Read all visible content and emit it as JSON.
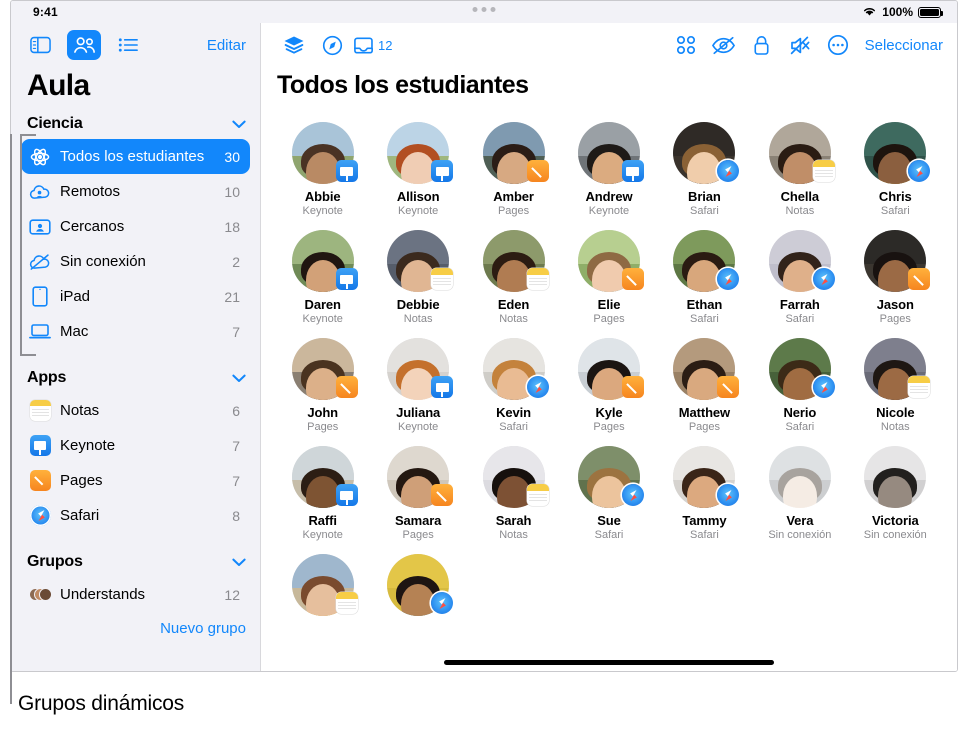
{
  "statusbar": {
    "time": "9:41",
    "battery_pct": "100%",
    "wifi_icon": "wifi-icon",
    "battery_icon": "battery-full-icon"
  },
  "sidebar": {
    "toolbar": {
      "sidebar_toggle_icon": "sidebar-toggle-icon",
      "people_icon": "people-icon",
      "list_icon": "list-icon",
      "edit_label": "Editar"
    },
    "title": "Aula",
    "class_section": {
      "label": "Ciencia",
      "chevron": "chevron-down-icon"
    },
    "class_items": [
      {
        "label": "Todos los estudiantes",
        "count": "30",
        "icon": "atom-icon",
        "selected": true
      },
      {
        "label": "Remotos",
        "count": "10",
        "icon": "cloud-person-icon",
        "selected": false
      },
      {
        "label": "Cercanos",
        "count": "18",
        "icon": "person-card-icon",
        "selected": false
      },
      {
        "label": "Sin conexión",
        "count": "2",
        "icon": "cloud-slash-icon",
        "selected": false
      },
      {
        "label": "iPad",
        "count": "21",
        "icon": "ipad-icon",
        "selected": false
      },
      {
        "label": "Mac",
        "count": "7",
        "icon": "laptop-icon",
        "selected": false
      }
    ],
    "apps_section": {
      "label": "Apps",
      "chevron": "chevron-down-icon"
    },
    "apps_items": [
      {
        "label": "Notas",
        "count": "6",
        "icon": "notes-app-icon"
      },
      {
        "label": "Keynote",
        "count": "7",
        "icon": "keynote-app-icon"
      },
      {
        "label": "Pages",
        "count": "7",
        "icon": "pages-app-icon"
      },
      {
        "label": "Safari",
        "count": "8",
        "icon": "safari-app-icon"
      }
    ],
    "groups_section": {
      "label": "Grupos",
      "chevron": "chevron-down-icon"
    },
    "groups_items": [
      {
        "label": "Understands",
        "count": "12",
        "icon": "group-avatars-icon"
      }
    ],
    "new_group_label": "Nuevo grupo"
  },
  "main": {
    "toolbar": {
      "layers_icon": "layers-icon",
      "navigate_icon": "compass-icon",
      "inbox_icon": "inbox-icon",
      "inbox_count": "12",
      "grid_icon": "grid-four-icon",
      "hide_screen_icon": "eye-slash-icon",
      "lock_icon": "lock-icon",
      "mute_icon": "speaker-slash-icon",
      "more_icon": "ellipsis-circle-icon",
      "select_label": "Seleccionar"
    },
    "title": "Todos los estudiantes",
    "students": [
      {
        "name": "Abbie",
        "app": "Keynote",
        "badge": "keynote",
        "skin": "#b98a64",
        "hair": "#4a3324",
        "bg_top": "#a9c4d8",
        "bg_bottom": "#8fa56f",
        "shirt": "#e7e3dd"
      },
      {
        "name": "Allison",
        "app": "Keynote",
        "badge": "keynote",
        "skin": "#f0cdb4",
        "hair": "#b24f22",
        "bg_top": "#bcd4e6",
        "bg_bottom": "#9fb77e",
        "shirt": "#efeae4"
      },
      {
        "name": "Amber",
        "app": "Pages",
        "badge": "pages",
        "skin": "#d7a982",
        "hair": "#2b1d16",
        "bg_top": "#7f9ab0",
        "bg_bottom": "#4f5f55",
        "shirt": "#3a3632"
      },
      {
        "name": "Andrew",
        "app": "Keynote",
        "badge": "keynote",
        "skin": "#dbab80",
        "hair": "#1e1a17",
        "bg_top": "#9aa0a5",
        "bg_bottom": "#6f7478",
        "shirt": "#2c2b29"
      },
      {
        "name": "Brian",
        "app": "Safari",
        "badge": "safari",
        "skin": "#f0cdab",
        "hair": "#8a6135",
        "bg_top": "#2f2a26",
        "bg_bottom": "#3a332c",
        "shirt": "#1d1a17"
      },
      {
        "name": "Chella",
        "app": "Notas",
        "badge": "notes",
        "skin": "#c08e68",
        "hair": "#2a1c13",
        "bg_top": "#b0a79a",
        "bg_bottom": "#8a8276",
        "shirt": "#2e2a26"
      },
      {
        "name": "Chris",
        "app": "Safari",
        "badge": "safari",
        "skin": "#8b5f3f",
        "hair": "#1d140e",
        "bg_top": "#3e6a5f",
        "bg_bottom": "#2f5249",
        "shirt": "#d9b33a"
      },
      {
        "name": "Daren",
        "app": "Keynote",
        "badge": "keynote",
        "skin": "#d2a178",
        "hair": "#201611",
        "bg_top": "#9db57f",
        "bg_bottom": "#6f8a56",
        "shirt": "#3f4a3a"
      },
      {
        "name": "Debbie",
        "app": "Notas",
        "badge": "notes",
        "skin": "#e0b693",
        "hair": "#3b2a1e",
        "bg_top": "#6b7382",
        "bg_bottom": "#565d6a",
        "shirt": "#e9e5df"
      },
      {
        "name": "Eden",
        "app": "Notas",
        "badge": "notes",
        "skin": "#b07c52",
        "hair": "#2c1c12",
        "bg_top": "#8d9a6b",
        "bg_bottom": "#6d7a4e",
        "shirt": "#d8d3cb"
      },
      {
        "name": "Elie",
        "app": "Pages",
        "badge": "pages",
        "skin": "#f0cbae",
        "hair": "#8e6a44",
        "bg_top": "#b7cf90",
        "bg_bottom": "#8fae68",
        "shirt": "#7fb3d5"
      },
      {
        "name": "Ethan",
        "app": "Safari",
        "badge": "safari",
        "skin": "#d8a77c",
        "hair": "#2a1b12",
        "bg_top": "#7e9a5c",
        "bg_bottom": "#5d7744",
        "shirt": "#2f5f9e"
      },
      {
        "name": "Farrah",
        "app": "Safari",
        "badge": "safari",
        "skin": "#dfb08a",
        "hair": "#32231a",
        "bg_top": "#cdccd6",
        "bg_bottom": "#bfbecb",
        "shirt": "#e4e2e6"
      },
      {
        "name": "Jason",
        "app": "Pages",
        "badge": "pages",
        "skin": "#9b6a45",
        "hair": "#181210",
        "bg_top": "#2c2a27",
        "bg_bottom": "#3b3630",
        "shirt": "#2f86d6"
      },
      {
        "name": "John",
        "app": "Pages",
        "badge": "pages",
        "skin": "#dcb089",
        "hair": "#4a3320",
        "bg_top": "#cbb79c",
        "bg_bottom": "#8a7f72",
        "shirt": "#55504c"
      },
      {
        "name": "Juliana",
        "app": "Keynote",
        "badge": "keynote",
        "skin": "#f3d3ba",
        "hair": "#c4702c",
        "bg_top": "#e3e1de",
        "bg_bottom": "#d5d2ce",
        "shirt": "#edebe8"
      },
      {
        "name": "Kevin",
        "app": "Safari",
        "badge": "safari",
        "skin": "#e9bb93",
        "hair": "#c4823c",
        "bg_top": "#e6e4e0",
        "bg_bottom": "#cfcdc8",
        "shirt": "#273a52"
      },
      {
        "name": "Kyle",
        "app": "Pages",
        "badge": "pages",
        "skin": "#dba87e",
        "hair": "#1b1512",
        "bg_top": "#dfe4e8",
        "bg_bottom": "#c8ced3",
        "shirt": "#e7c83b"
      },
      {
        "name": "Matthew",
        "app": "Pages",
        "badge": "pages",
        "skin": "#d9a97f",
        "hair": "#2b1d14",
        "bg_top": "#b49a7d",
        "bg_bottom": "#9a8165",
        "shirt": "#b08b5d"
      },
      {
        "name": "Nerio",
        "app": "Safari",
        "badge": "safari",
        "skin": "#a06c42",
        "hair": "#3c2a17",
        "bg_top": "#5d7a4a",
        "bg_bottom": "#47613a",
        "shirt": "#ecebe7"
      },
      {
        "name": "Nicole",
        "app": "Notas",
        "badge": "notes",
        "skin": "#9c6a44",
        "hair": "#1e1713",
        "bg_top": "#7e7f8d",
        "bg_bottom": "#6a6b78",
        "shirt": "#2a2a30"
      },
      {
        "name": "Raffi",
        "app": "Keynote",
        "badge": "keynote",
        "skin": "#7e5433",
        "hair": "#2c1e14",
        "bg_top": "#cfd6d9",
        "bg_bottom": "#c6bda9",
        "shirt": "#21707a"
      },
      {
        "name": "Samara",
        "app": "Pages",
        "badge": "pages",
        "skin": "#cf9f78",
        "hair": "#241811",
        "bg_top": "#ded8cf",
        "bg_bottom": "#cfc7bb",
        "shirt": "#4c4a4a"
      },
      {
        "name": "Sarah",
        "app": "Notas",
        "badge": "notes",
        "skin": "#7d5134",
        "hair": "#16100d",
        "bg_top": "#e7e6ea",
        "bg_bottom": "#dcdbe0",
        "shirt": "#f0eeef"
      },
      {
        "name": "Sue",
        "app": "Safari",
        "badge": "safari",
        "skin": "#ecc49d",
        "hair": "#9c7340",
        "bg_top": "#7e8f6a",
        "bg_bottom": "#60724d",
        "shirt": "#4b5b6b"
      },
      {
        "name": "Tammy",
        "app": "Safari",
        "badge": "safari",
        "skin": "#dca97f",
        "hair": "#3a2518",
        "bg_top": "#e8e6e3",
        "bg_bottom": "#d6d3cf",
        "shirt": "#2e2c2b"
      },
      {
        "name": "Vera",
        "app": "Sin conexión",
        "badge": "none",
        "skin": "#ecc7a9",
        "hair": "#9e8b75",
        "bg_top": "#b9c3cb",
        "bg_bottom": "#a9b3bb",
        "shirt": "#e6e4e2",
        "offline": true
      },
      {
        "name": "Victoria",
        "app": "Sin conexión",
        "badge": "none",
        "skin": "#a1714c",
        "hair": "#241a14",
        "bg_top": "#c7c5c7",
        "bg_bottom": "#b5b3b5",
        "shirt": "#d8a9a6",
        "offline": true
      },
      {
        "name": "",
        "app": "",
        "badge": "notes",
        "skin": "#e6bf9d",
        "hair": "#7a4b2e",
        "bg_top": "#9fb7cd",
        "bg_bottom": "#c7b89a",
        "shirt": "#e8c53c",
        "partial": true
      },
      {
        "name": "",
        "app": "",
        "badge": "safari",
        "skin": "#b58254",
        "hair": "#1e1512",
        "bg_top": "#e3c648",
        "bg_bottom": "#d7bb3e",
        "shirt": "#46a7d8",
        "partial": true
      }
    ],
    "home_indicator": "home-indicator"
  },
  "callout": {
    "label": "Grupos dinámicos"
  }
}
